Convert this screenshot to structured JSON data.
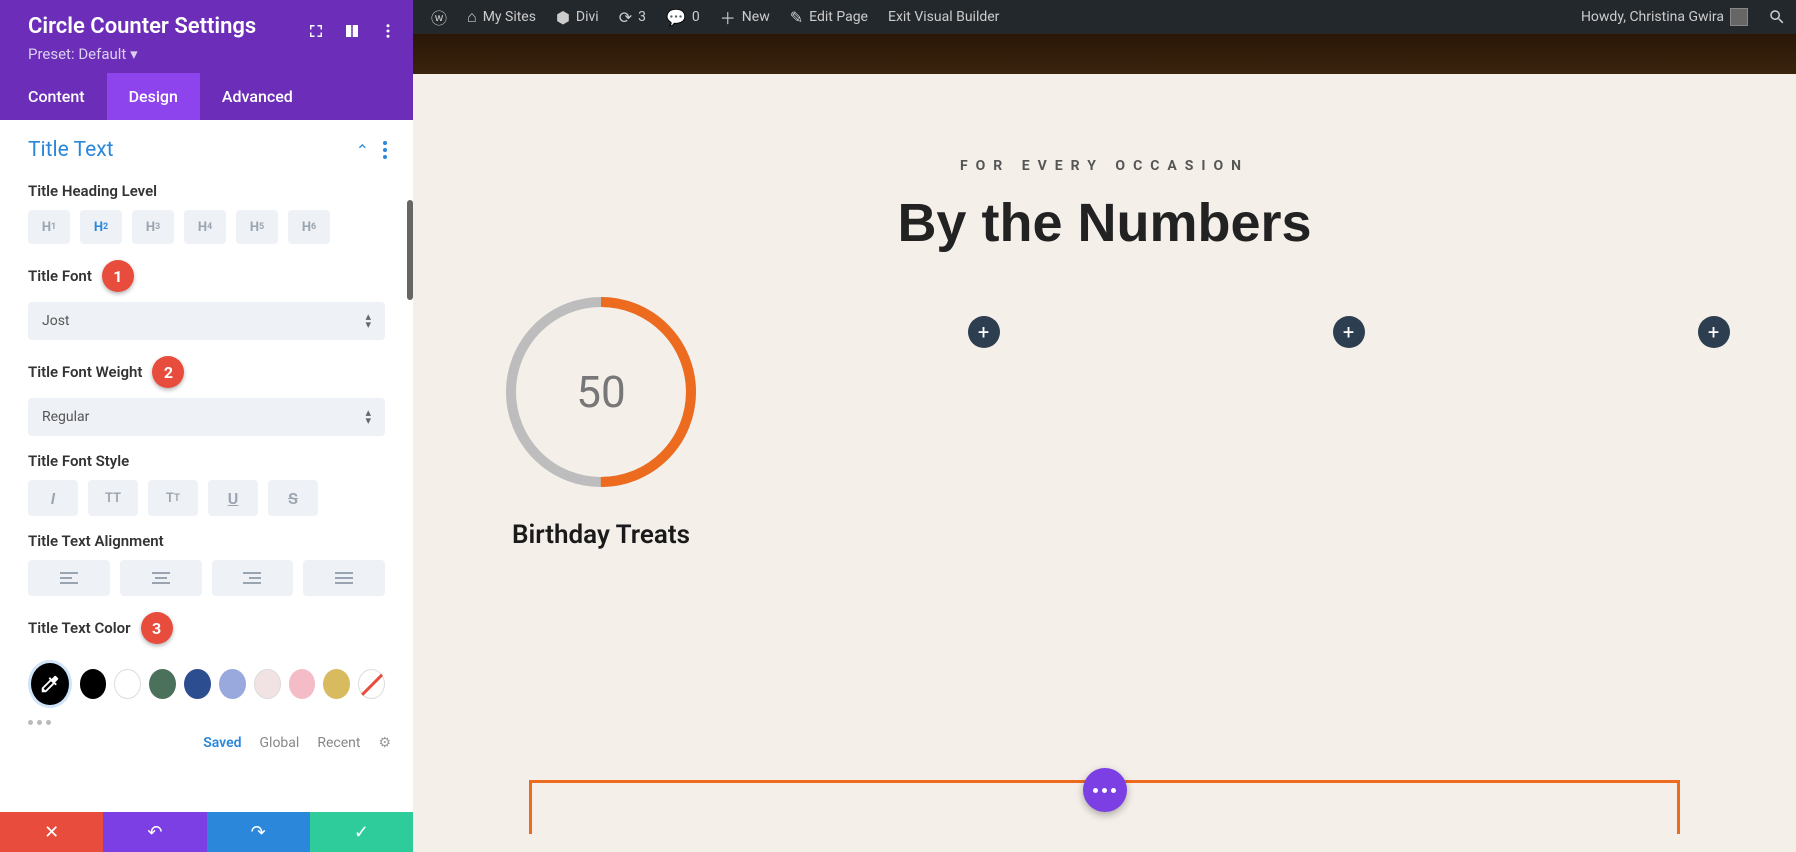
{
  "wp_bar": {
    "my_sites": "My Sites",
    "divi": "Divi",
    "updates_count": "3",
    "comments_count": "0",
    "new": "New",
    "edit_page": "Edit Page",
    "exit_vb": "Exit Visual Builder",
    "howdy": "Howdy, Christina Gwira"
  },
  "sidebar": {
    "title": "Circle Counter Settings",
    "preset": "Preset: Default",
    "tabs": {
      "content": "Content",
      "design": "Design",
      "advanced": "Advanced"
    },
    "section_title": "Title Text",
    "heading_level_label": "Title Heading Level",
    "heading_levels": [
      "H1",
      "H2",
      "H3",
      "H4",
      "H5",
      "H6"
    ],
    "title_font_label": "Title Font",
    "title_font_value": "Jost",
    "title_font_weight_label": "Title Font Weight",
    "title_font_weight_value": "Regular",
    "title_font_style_label": "Title Font Style",
    "title_text_align_label": "Title Text Alignment",
    "title_text_color_label": "Title Text Color",
    "colors": [
      "#000000",
      "#ffffff",
      "#4b715d",
      "#2c4d8f",
      "#9aa9dd",
      "#f1e2e3",
      "#f4bcc6",
      "#d8bb5f"
    ],
    "footer": {
      "saved": "Saved",
      "global": "Global",
      "recent": "Recent"
    },
    "annotations": {
      "a1": "1",
      "a2": "2",
      "a3": "3"
    }
  },
  "preview": {
    "subtitle": "FOR EVERY OCCASION",
    "title": "By the Numbers",
    "counter": {
      "value": "50",
      "percent": 50,
      "label": "Birthday Treats"
    }
  }
}
